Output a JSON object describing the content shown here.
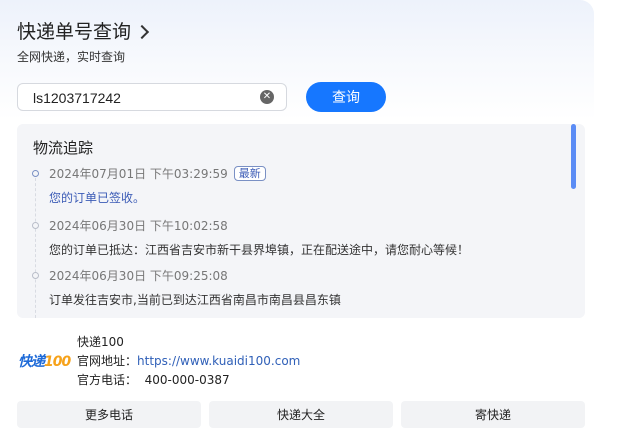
{
  "header": {
    "title": "快递单号查询"
  },
  "subtitle": "全网快递，实时查询",
  "search": {
    "value": "ls1203717242",
    "button_label": "查询"
  },
  "tracking": {
    "title": "物流追踪",
    "events": [
      {
        "time": "2024年07月01日 下午03:29:59",
        "badge": "最新",
        "desc": "您的订单已签收。"
      },
      {
        "time": "2024年06月30日 下午10:02:58",
        "badge": "",
        "desc": "您的订单已抵达：江西省吉安市新干县界埠镇，正在配送途中，请您耐心等候！"
      },
      {
        "time": "2024年06月30日 下午09:25:08",
        "badge": "",
        "desc": "订单发往吉安市,当前已到达江西省南昌市南昌县昌东镇"
      }
    ]
  },
  "company": {
    "logo_text": "快递",
    "logo_num": "100",
    "name": "快递100",
    "website_label": "官网地址：",
    "website": "https://www.kuaidi100.com",
    "phone_label": "官方电话：",
    "phone": "400-000-0387"
  },
  "bottom_buttons": [
    "更多电话",
    "快递大全",
    "寄快递"
  ]
}
